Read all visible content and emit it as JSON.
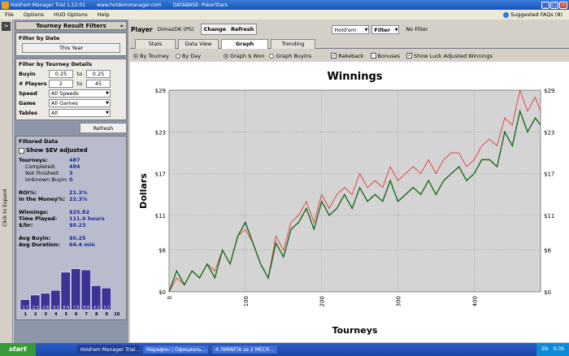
{
  "titlebar": {
    "title": "Hold'em Manager Trial 1.12.01",
    "url": "www.holdemmanager.com",
    "database": "DATABASE: PokerStars"
  },
  "menu": {
    "items": [
      "File",
      "Options",
      "HUD Options",
      "Help"
    ],
    "faq": "Suggested FAQs (8)"
  },
  "left_strip": {
    "arrow": ">",
    "label": "Click to Expand"
  },
  "sidebar": {
    "title": "Tourney Result Filters",
    "collapse": "«",
    "date_section": {
      "title": "Filter by Date",
      "button": "This Year"
    },
    "details_section": {
      "title": "Filter by Tourney Details",
      "buyin": {
        "label": "Buyin",
        "from": "0.25",
        "to_label": "to",
        "to": "0.25"
      },
      "players": {
        "label": "# Players",
        "from": "2",
        "to_label": "to",
        "to": "45"
      },
      "speed": {
        "label": "Speed",
        "value": "All Speeds"
      },
      "game": {
        "label": "Game",
        "value": "All Games"
      },
      "tables": {
        "label": "Tables",
        "value": "All"
      }
    },
    "refresh_button": "Refresh",
    "filtered": {
      "title": "Filtered Data",
      "show_ev": "Show $EV adjusted",
      "stats": [
        {
          "k": "Tourneys:",
          "v": "487",
          "sub": false
        },
        {
          "k": "Completed:",
          "v": "484",
          "sub": true
        },
        {
          "k": "Not Finished:",
          "v": "3",
          "sub": true
        },
        {
          "k": "Unknown Buyin:",
          "v": "0",
          "sub": true
        },
        {
          "k": "",
          "v": "",
          "sub": false
        },
        {
          "k": "ROI%:",
          "v": "21.3%",
          "sub": false
        },
        {
          "k": "In the Money%:",
          "v": "22.3%",
          "sub": false
        },
        {
          "k": "",
          "v": "",
          "sub": false
        },
        {
          "k": "Winnings:",
          "v": "$25.82",
          "sub": false
        },
        {
          "k": "Time Played:",
          "v": "111.9 hours",
          "sub": false
        },
        {
          "k": "$/hr:",
          "v": "$0.23",
          "sub": false
        },
        {
          "k": "",
          "v": "",
          "sub": false
        },
        {
          "k": "Avg Buyin:",
          "v": "$0.25",
          "sub": false
        },
        {
          "k": "Avg Duration:",
          "v": "64.4 min",
          "sub": false
        }
      ],
      "histogram": {
        "values": [
          1.7,
          2.5,
          2.8,
          3.3,
          6.4,
          7.0,
          6.8,
          4.1,
          3.7
        ],
        "labels": [
          "1.7",
          "2.5",
          "2.8",
          "3.3",
          "6.4",
          "7.0",
          "6.8",
          "4.1",
          "3.7"
        ],
        "positions": [
          "1",
          "2",
          "3",
          "4",
          "5",
          "6",
          "7",
          "8",
          "9",
          "10"
        ],
        "color": "#3c3494"
      }
    }
  },
  "header": {
    "player_label": "Player",
    "player_value": "DimazDK (PS)",
    "change": "Change",
    "refresh": "Refresh",
    "game_select": "Hold'em",
    "filter": "Filter",
    "no_filter": "No Filter"
  },
  "tabs": [
    "Stats",
    "Data View",
    "Graph",
    "Trending"
  ],
  "active_tab": "Graph",
  "options": {
    "by_tourney": "By Tourney",
    "by_day": "By Day",
    "graph_won": "Graph $ Won",
    "graph_buyins": "Graph Buyins",
    "rakeback": "Rakeback",
    "bonuses": "Bonuses",
    "show_luck": "Show Luck Adjusted Winnings"
  },
  "chart_data": {
    "type": "line",
    "title": "Winnings",
    "xlabel": "Tourneys",
    "ylabel": "Dollars",
    "xlim": [
      0,
      487
    ],
    "ylim": [
      0,
      29
    ],
    "x_ticks": [
      "0",
      "100",
      "200",
      "300",
      "400"
    ],
    "y_ticks": [
      "$0",
      "$6",
      "$11",
      "$17",
      "$23",
      "$29"
    ],
    "grid": true,
    "series": [
      {
        "color": "#1a6a1a",
        "x": [
          0,
          10,
          20,
          30,
          40,
          50,
          60,
          70,
          80,
          90,
          100,
          110,
          120,
          130,
          140,
          150,
          160,
          170,
          180,
          190,
          200,
          210,
          220,
          230,
          240,
          250,
          260,
          270,
          280,
          290,
          300,
          310,
          320,
          330,
          340,
          350,
          360,
          370,
          380,
          390,
          400,
          410,
          420,
          430,
          440,
          450,
          460,
          470,
          480,
          487
        ],
        "values": [
          0,
          3,
          1,
          3,
          2,
          4,
          2,
          6,
          4,
          8,
          10,
          7,
          4,
          2,
          7,
          5,
          9,
          10,
          12,
          9,
          13,
          11,
          12,
          14,
          12,
          15,
          13,
          14,
          13,
          16,
          13,
          14,
          15,
          14,
          16,
          14,
          16,
          17,
          18,
          16,
          17,
          19,
          19,
          18,
          23,
          21,
          26,
          23,
          25,
          24
        ]
      },
      {
        "color": "#e04848",
        "x": [
          0,
          10,
          20,
          30,
          40,
          50,
          60,
          70,
          80,
          90,
          100,
          110,
          120,
          130,
          140,
          150,
          160,
          170,
          180,
          190,
          200,
          210,
          220,
          230,
          240,
          250,
          260,
          270,
          280,
          290,
          300,
          310,
          320,
          330,
          340,
          350,
          360,
          370,
          380,
          390,
          400,
          410,
          420,
          430,
          440,
          450,
          460,
          470,
          480,
          487
        ],
        "values": [
          0,
          2,
          1,
          3,
          2,
          4,
          3,
          6,
          4,
          8,
          9,
          7,
          4,
          2,
          8,
          6,
          10,
          11,
          13,
          10,
          14,
          12,
          14,
          15,
          14,
          17,
          15,
          16,
          15,
          18,
          16,
          17,
          18,
          17,
          19,
          17,
          19,
          20,
          20,
          18,
          19,
          21,
          22,
          21,
          25,
          24,
          29,
          26,
          28,
          26
        ]
      }
    ]
  },
  "taskbar": {
    "start": "start",
    "tasks": [
      "Hold'em Manager Trial...",
      "Марафон | Официаль...",
      "4 ЛИМИТА за 2 МЕСЯ..."
    ],
    "lang": "EN",
    "clock": "9:39"
  }
}
